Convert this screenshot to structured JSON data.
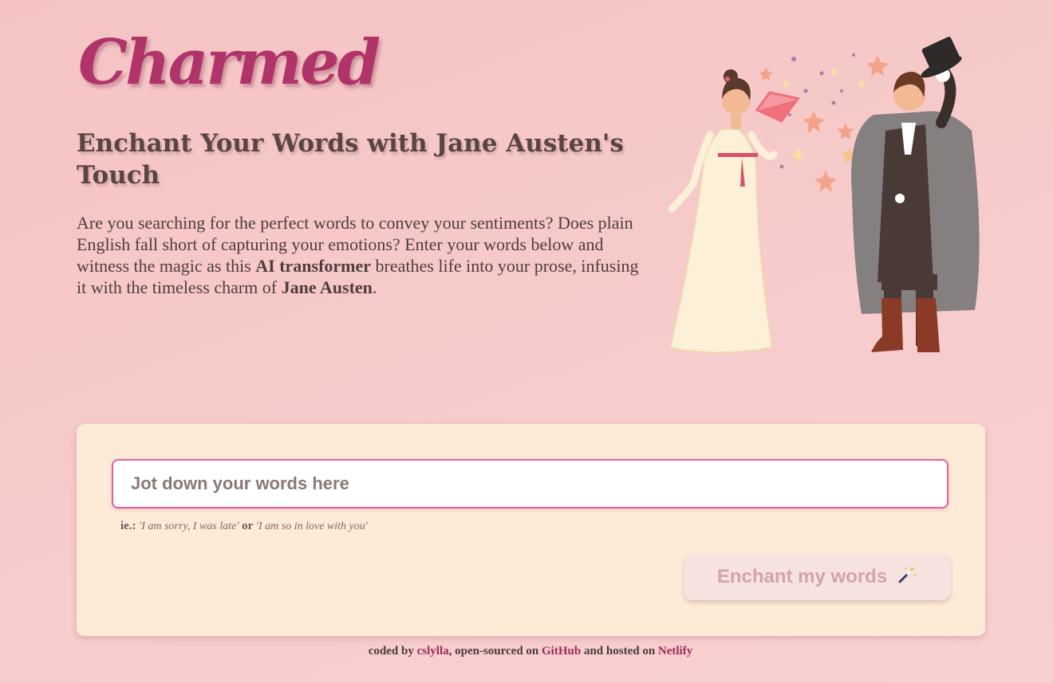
{
  "header": {
    "logo": "Charmed",
    "headline": "Enchant Your Words with Jane Austen's Touch",
    "intro": {
      "part1": "Are you searching for the perfect words to convey your sentiments? Does plain English fall short of capturing your emotions? Enter your words below and witness the magic as this ",
      "bold1": "AI transformer",
      "part2": " breathes life into your prose, infusing it with the timeless charm of ",
      "bold2": "Jane Austen",
      "part3": "."
    }
  },
  "form": {
    "input_placeholder": "Jot down your words here",
    "input_value": "",
    "hint_label": "ie.:",
    "example1": "'I am sorry, I was late'",
    "hint_or": "or",
    "example2": "'I am so in love with you'",
    "button_label": "Enchant my words",
    "button_icon": "magic-wand-icon"
  },
  "footer": {
    "prefix": "coded by ",
    "author": "cslylla",
    "mid1": ", open-sourced on ",
    "github": "GitHub",
    "mid2": " and hosted on ",
    "netlify": "Netlify"
  },
  "colors": {
    "background": "#f6c6c6",
    "logo": "#b0346a",
    "card": "#fdebd7",
    "input_border": "#e060a6",
    "button_bg": "#f6e3e0",
    "button_text": "#d3a4a8",
    "link": "#9b2a5a"
  }
}
